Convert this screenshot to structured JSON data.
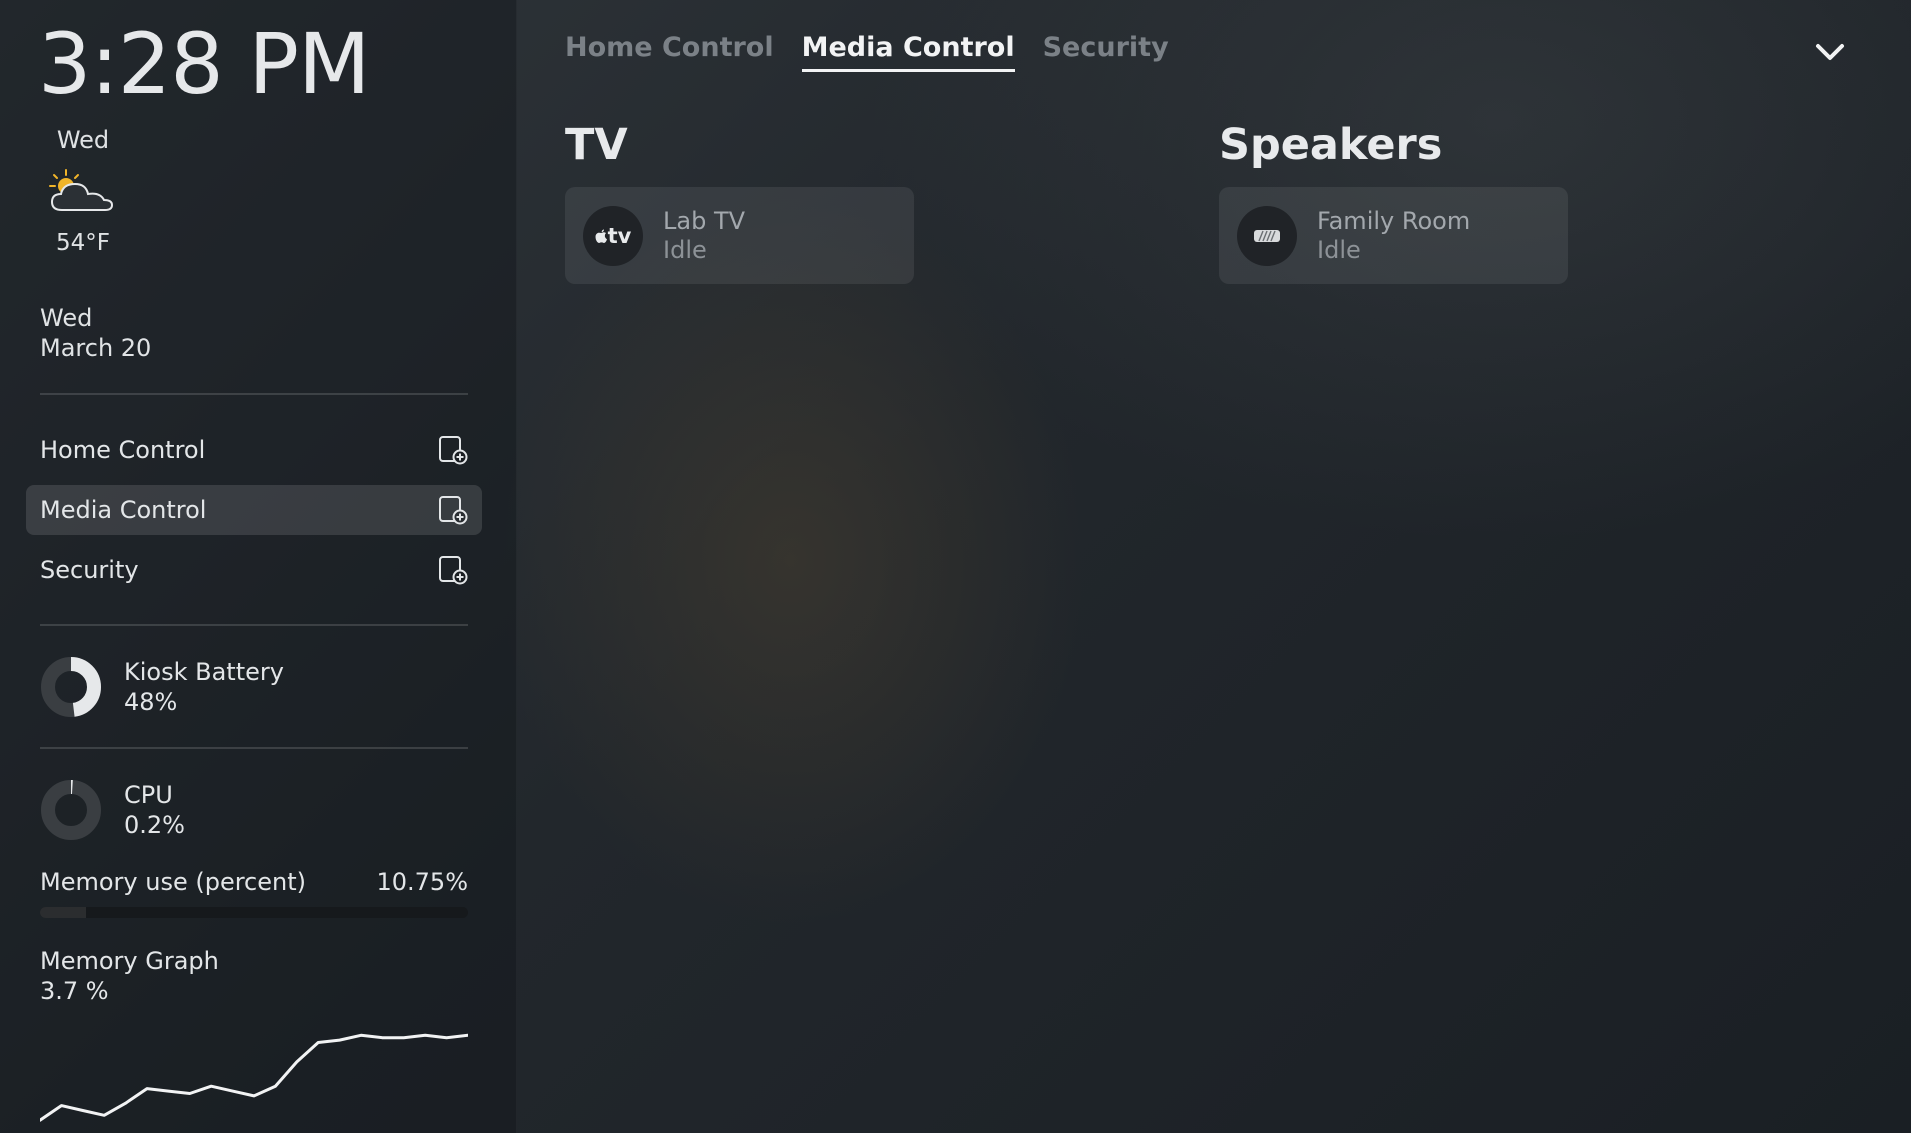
{
  "clock": {
    "time": "3:28 PM"
  },
  "weather": {
    "day": "Wed",
    "icon": "partly-cloudy-icon",
    "temperature": "54°F"
  },
  "date": {
    "weekday": "Wed",
    "date": "March 20"
  },
  "sidebar": {
    "items": [
      {
        "label": "Home Control",
        "icon": "add-panel-icon"
      },
      {
        "label": "Media Control",
        "icon": "add-panel-icon",
        "active": true
      },
      {
        "label": "Security",
        "icon": "add-panel-icon"
      }
    ]
  },
  "battery": {
    "label": "Kiosk Battery",
    "value": "48%",
    "fraction": 0.48
  },
  "cpu": {
    "label": "CPU",
    "value": "0.2%",
    "fraction": 0.002
  },
  "memory": {
    "label": "Memory use (percent)",
    "value": "10.75%",
    "fraction": 0.1075
  },
  "memory_graph": {
    "label": "Memory Graph",
    "value": "3.7 %",
    "series": [
      0.2,
      0.8,
      0.6,
      0.4,
      0.9,
      1.5,
      1.4,
      1.3,
      1.6,
      1.4,
      1.2,
      1.6,
      2.6,
      3.4,
      3.5,
      3.7,
      3.6,
      3.6,
      3.7,
      3.6,
      3.7
    ]
  },
  "tabs": [
    {
      "label": "Home Control"
    },
    {
      "label": "Media Control",
      "active": true
    },
    {
      "label": "Security"
    }
  ],
  "sections": {
    "tv": {
      "title": "TV",
      "device": {
        "name": "Lab TV",
        "state": "Idle",
        "icon": "apple-tv-icon",
        "icon_text": "tv"
      }
    },
    "speakers": {
      "title": "Speakers",
      "device": {
        "name": "Family Room",
        "state": "Idle",
        "icon": "speaker-icon"
      }
    }
  }
}
